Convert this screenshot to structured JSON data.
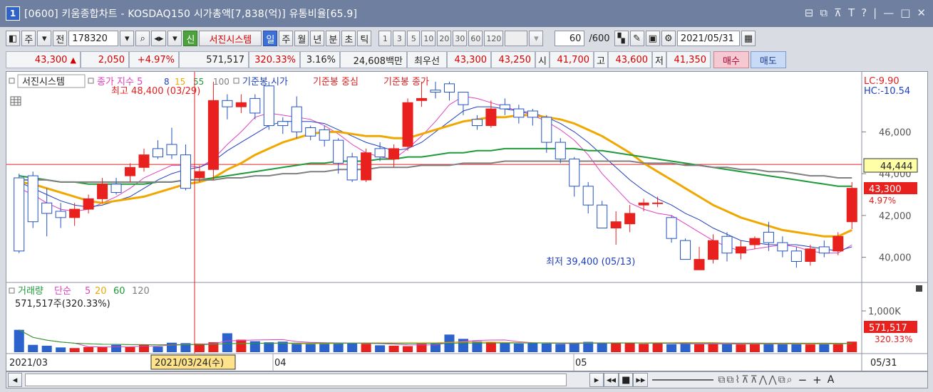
{
  "window": {
    "index": "1",
    "title": "[0600] 키움종합차트 - KOSDAQ150 시가총액[7,838(억)] 유통비율[65.9]",
    "controls": [
      "⊟",
      "⧉",
      "⊼",
      "T",
      "?",
      "|",
      "—",
      "□",
      "✕"
    ]
  },
  "toolbar": {
    "market": "주",
    "prev_label": "전",
    "code": "178320",
    "sinho": "신",
    "company": "서진시스템",
    "periods": [
      "일",
      "주",
      "월",
      "년",
      "분",
      "초",
      "틱"
    ],
    "active_period": "일",
    "intervals": [
      "1",
      "3",
      "5",
      "10",
      "20",
      "30",
      "60",
      "120"
    ],
    "count": "60",
    "count_total": "/600",
    "date": "2021/05/31"
  },
  "quote": {
    "price": "43,300",
    "change": "2,050",
    "change_pct": "+4.97%",
    "volume": "571,517",
    "vol_ratio": "320.33%",
    "turnover": "3.16%",
    "amount": "24,608백만",
    "best_label": "최우선",
    "best_ask": "43,300",
    "best_bid": "43,250",
    "open_label": "시",
    "open": "41,700",
    "high_label": "고",
    "high": "43,600",
    "low_label": "저",
    "low": "41,350",
    "buy": "매수",
    "sell": "매도"
  },
  "chart": {
    "legend_name": "서진시스템",
    "legend_ma": "종가 지수 5",
    "ma_periods": [
      "8",
      "15",
      "55",
      "100"
    ],
    "legend_base": "기준봉 시가",
    "legend_base_mid": "기준봉 중심",
    "legend_base_close": "기준봉 종가",
    "high_marker": "최고 48,400 (03/29)",
    "low_marker": "최저 39,400 (05/13)",
    "lc": "LC:9.90",
    "hc": "HC:-10.54",
    "y_ticks": [
      "46,000",
      "44,000",
      "42,000",
      "40,000"
    ],
    "hline_value": "44,444",
    "current_price": "43,300",
    "current_pct": "4.97%",
    "vol_legend": "거래량",
    "vol_ma_label": "단순",
    "vol_ma": [
      "5",
      "20",
      "60",
      "120"
    ],
    "vol_summary": "571,517주(320.33%)",
    "vol_tick": "1,000K",
    "vol_current": "571,517",
    "vol_current_pct": "320.33%",
    "x_labels": [
      "2021/03",
      "04",
      "05"
    ],
    "crosshair_date": "2021/03/24(수)",
    "end_date": "05/31"
  },
  "chart_data": {
    "type": "candlestick",
    "y_range": [
      39000,
      48600
    ],
    "colors": {
      "up": "#e8201e",
      "down": "#ffffff",
      "down_border": "#2453c2",
      "hline": "#e02020"
    },
    "candles": [
      {
        "o": 43800,
        "c": 40300,
        "h": 44000,
        "l": 40200
      },
      {
        "o": 43900,
        "c": 41700,
        "h": 44100,
        "l": 41400
      },
      {
        "o": 42600,
        "c": 42100,
        "h": 43300,
        "l": 41000
      },
      {
        "o": 42200,
        "c": 41900,
        "h": 42600,
        "l": 41400
      },
      {
        "o": 41900,
        "c": 42300,
        "h": 42600,
        "l": 41500
      },
      {
        "o": 42300,
        "c": 42800,
        "h": 43000,
        "l": 42100
      },
      {
        "o": 42800,
        "c": 43500,
        "h": 43800,
        "l": 42600
      },
      {
        "o": 43500,
        "c": 43100,
        "h": 43800,
        "l": 43000
      },
      {
        "o": 43900,
        "c": 44300,
        "h": 44500,
        "l": 43600
      },
      {
        "o": 44300,
        "c": 44900,
        "h": 45200,
        "l": 44100
      },
      {
        "o": 45200,
        "c": 44800,
        "h": 45600,
        "l": 44700
      },
      {
        "o": 45400,
        "c": 44900,
        "h": 46200,
        "l": 44700
      },
      {
        "o": 44900,
        "c": 43300,
        "h": 45400,
        "l": 43200
      },
      {
        "o": 43800,
        "c": 44100,
        "h": 44400,
        "l": 43600
      },
      {
        "o": 44200,
        "c": 47500,
        "h": 48400,
        "l": 43700
      },
      {
        "o": 47500,
        "c": 47200,
        "h": 47800,
        "l": 46600
      },
      {
        "o": 47200,
        "c": 47400,
        "h": 47800,
        "l": 46900
      },
      {
        "o": 47600,
        "c": 46900,
        "h": 47800,
        "l": 46600
      },
      {
        "o": 48200,
        "c": 46300,
        "h": 48400,
        "l": 46100
      },
      {
        "o": 46500,
        "c": 46300,
        "h": 46700,
        "l": 45900
      },
      {
        "o": 47200,
        "c": 46000,
        "h": 47700,
        "l": 45700
      },
      {
        "o": 46200,
        "c": 45800,
        "h": 46300,
        "l": 45600
      },
      {
        "o": 46100,
        "c": 45600,
        "h": 46300,
        "l": 45300
      },
      {
        "o": 45600,
        "c": 44500,
        "h": 45700,
        "l": 44000
      },
      {
        "o": 44800,
        "c": 43700,
        "h": 45000,
        "l": 43600
      },
      {
        "o": 43700,
        "c": 45000,
        "h": 45200,
        "l": 43600
      },
      {
        "o": 45200,
        "c": 44800,
        "h": 45500,
        "l": 44600
      },
      {
        "o": 44700,
        "c": 45200,
        "h": 45400,
        "l": 44300
      },
      {
        "o": 45300,
        "c": 47400,
        "h": 47600,
        "l": 45100
      },
      {
        "o": 47500,
        "c": 47600,
        "h": 48400,
        "l": 47200
      },
      {
        "o": 48000,
        "c": 47900,
        "h": 48400,
        "l": 47600
      },
      {
        "o": 48300,
        "c": 47900,
        "h": 48400,
        "l": 47500
      },
      {
        "o": 47900,
        "c": 47300,
        "h": 47900,
        "l": 46800
      },
      {
        "o": 46600,
        "c": 46300,
        "h": 46800,
        "l": 46100
      },
      {
        "o": 46300,
        "c": 47100,
        "h": 47500,
        "l": 46200
      },
      {
        "o": 47300,
        "c": 47100,
        "h": 47600,
        "l": 46800
      },
      {
        "o": 47100,
        "c": 46700,
        "h": 47300,
        "l": 46400
      },
      {
        "o": 47000,
        "c": 46700,
        "h": 47100,
        "l": 46300
      },
      {
        "o": 46700,
        "c": 45500,
        "h": 46800,
        "l": 45000
      },
      {
        "o": 45500,
        "c": 44700,
        "h": 45700,
        "l": 44500
      },
      {
        "o": 44700,
        "c": 43400,
        "h": 44800,
        "l": 42900
      },
      {
        "o": 43400,
        "c": 42500,
        "h": 43600,
        "l": 42100
      },
      {
        "o": 42500,
        "c": 41400,
        "h": 42700,
        "l": 41400
      },
      {
        "o": 41400,
        "c": 41700,
        "h": 42200,
        "l": 40600
      },
      {
        "o": 41600,
        "c": 42100,
        "h": 42500,
        "l": 41200
      },
      {
        "o": 42500,
        "c": 42600,
        "h": 42800,
        "l": 42200
      },
      {
        "o": 42600,
        "c": 42600,
        "h": 42900,
        "l": 42400
      },
      {
        "o": 41900,
        "c": 40900,
        "h": 42000,
        "l": 40700
      },
      {
        "o": 40800,
        "c": 39900,
        "h": 40900,
        "l": 39900
      },
      {
        "o": 39400,
        "c": 39900,
        "h": 40500,
        "l": 39400
      },
      {
        "o": 39900,
        "c": 40800,
        "h": 41100,
        "l": 39700
      },
      {
        "o": 41000,
        "c": 40200,
        "h": 41200,
        "l": 39800
      },
      {
        "o": 40200,
        "c": 40500,
        "h": 40800,
        "l": 39900
      },
      {
        "o": 40600,
        "c": 40900,
        "h": 41000,
        "l": 40400
      },
      {
        "o": 41200,
        "c": 40700,
        "h": 41700,
        "l": 40300
      },
      {
        "o": 40700,
        "c": 40300,
        "h": 41000,
        "l": 40000
      },
      {
        "o": 40300,
        "c": 39800,
        "h": 40500,
        "l": 39500
      },
      {
        "o": 39800,
        "c": 40400,
        "h": 40600,
        "l": 39600
      },
      {
        "o": 40500,
        "c": 40200,
        "h": 40800,
        "l": 40000
      },
      {
        "o": 40300,
        "c": 41000,
        "h": 41200,
        "l": 40100
      },
      {
        "o": 41700,
        "c": 43300,
        "h": 43600,
        "l": 41350
      }
    ],
    "volumes": [
      520,
      170,
      150,
      110,
      95,
      120,
      120,
      170,
      120,
      180,
      130,
      220,
      210,
      200,
      230,
      440,
      290,
      255,
      230,
      245,
      215,
      195,
      215,
      210,
      215,
      195,
      160,
      150,
      140,
      195,
      200,
      410,
      310,
      255,
      230,
      215,
      200,
      210,
      200,
      190,
      200,
      240,
      210,
      220,
      210,
      195,
      200,
      185,
      195,
      185,
      200,
      190,
      180,
      195,
      200,
      185,
      195,
      180,
      190,
      200,
      245
    ],
    "volume_scale_k": 1700,
    "ma_lines": {
      "ma5": [
        43300,
        43000,
        42600,
        42300,
        42200,
        42300,
        42600,
        42900,
        43300,
        43800,
        44100,
        44400,
        44400,
        44300,
        44700,
        45400,
        46000,
        46700,
        46900,
        46800,
        46700,
        46600,
        46300,
        45900,
        45400,
        45000,
        44800,
        44700,
        45200,
        45800,
        46500,
        47300,
        47700,
        47600,
        47400,
        47200,
        47000,
        46800,
        46500,
        46100,
        45600,
        44900,
        44000,
        43300,
        42600,
        42300,
        42100,
        42000,
        41600,
        41200,
        40800,
        40500,
        40300,
        40400,
        40500,
        40600,
        40500,
        40300,
        40200,
        40200,
        40600
      ],
      "ma8": [
        43600,
        43300,
        43000,
        42700,
        42500,
        42400,
        42500,
        42700,
        42900,
        43300,
        43700,
        44000,
        44200,
        44300,
        44600,
        45100,
        45500,
        45900,
        46300,
        46500,
        46500,
        46500,
        46400,
        46100,
        45800,
        45500,
        45300,
        45100,
        45200,
        45500,
        46000,
        46500,
        47000,
        47200,
        47200,
        47100,
        47000,
        46900,
        46700,
        46400,
        46000,
        45500,
        44900,
        44300,
        43700,
        43200,
        42800,
        42500,
        42100,
        41800,
        41400,
        41100,
        40800,
        40700,
        40600,
        40600,
        40600,
        40500,
        40400,
        40300,
        40500
      ],
      "ma15": [
        43600,
        43500,
        43300,
        43100,
        42900,
        42700,
        42600,
        42700,
        42800,
        42900,
        43100,
        43300,
        43500,
        43600,
        43800,
        44200,
        44500,
        44900,
        45200,
        45500,
        45700,
        45900,
        46000,
        46000,
        45900,
        45800,
        45800,
        45700,
        45700,
        45900,
        46100,
        46300,
        46500,
        46600,
        46700,
        46700,
        46800,
        46800,
        46700,
        46600,
        46400,
        46100,
        45800,
        45400,
        45000,
        44500,
        44100,
        43700,
        43300,
        42900,
        42500,
        42200,
        41900,
        41700,
        41500,
        41300,
        41200,
        41100,
        41000,
        41000,
        41300
      ],
      "ma55": [
        43900,
        43800,
        43700,
        43600,
        43600,
        43500,
        43500,
        43500,
        43500,
        43500,
        43600,
        43600,
        43700,
        43700,
        43800,
        43900,
        44000,
        44100,
        44200,
        44300,
        44400,
        44500,
        44500,
        44600,
        44600,
        44600,
        44700,
        44700,
        44800,
        44800,
        44900,
        45000,
        45000,
        45100,
        45100,
        45200,
        45200,
        45200,
        45200,
        45200,
        45200,
        45100,
        45100,
        45000,
        44900,
        44800,
        44700,
        44600,
        44500,
        44400,
        44300,
        44200,
        44100,
        44000,
        43900,
        43800,
        43700,
        43600,
        43500,
        43400,
        43400
      ],
      "ma100": [
        43700,
        43700,
        43700,
        43600,
        43600,
        43600,
        43600,
        43600,
        43600,
        43600,
        43600,
        43600,
        43700,
        43700,
        43700,
        43800,
        43800,
        43900,
        43900,
        44000,
        44000,
        44100,
        44100,
        44200,
        44200,
        44200,
        44300,
        44300,
        44300,
        44400,
        44400,
        44400,
        44500,
        44500,
        44500,
        44600,
        44600,
        44600,
        44600,
        44600,
        44600,
        44600,
        44600,
        44600,
        44600,
        44500,
        44500,
        44500,
        44400,
        44400,
        44300,
        44300,
        44200,
        44200,
        44100,
        44100,
        44000,
        43900,
        43900,
        43800,
        43800
      ]
    },
    "ma_colors": {
      "ma5": "#e040c0",
      "ma8": "#1e3fbf",
      "ma15": "#f0a800",
      "ma55": "#1f9a3a",
      "ma100": "#808080"
    }
  }
}
